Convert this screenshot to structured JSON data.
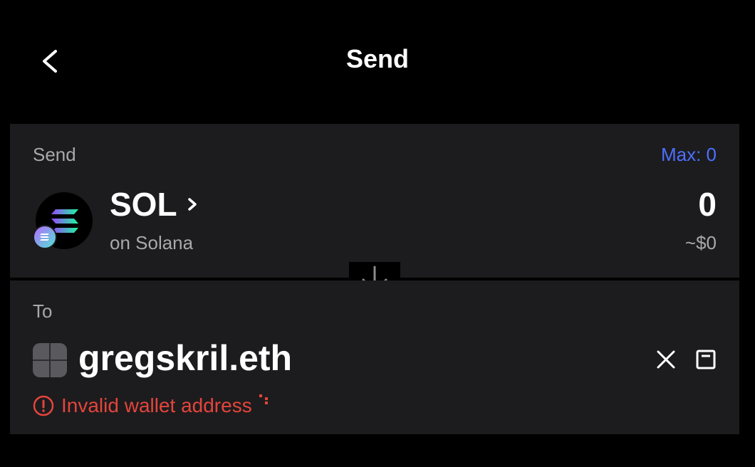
{
  "header": {
    "title": "Send"
  },
  "send": {
    "label": "Send",
    "max_label": "Max: 0",
    "token": {
      "symbol": "SOL",
      "network": "on Solana"
    },
    "amount": "0",
    "fiat": "~$0"
  },
  "to": {
    "label": "To",
    "address": "gregskril.eth",
    "error": "Invalid wallet address"
  },
  "colors": {
    "accent": "#4c6fff",
    "error": "#e5443b",
    "card": "#1c1c1e",
    "background": "#000000"
  },
  "icons": [
    "back-chevron-icon",
    "solana-logo-icon",
    "network-badge-icon",
    "chevron-right-icon",
    "arrow-down-icon",
    "close-icon",
    "save-contact-icon",
    "error-icon"
  ]
}
